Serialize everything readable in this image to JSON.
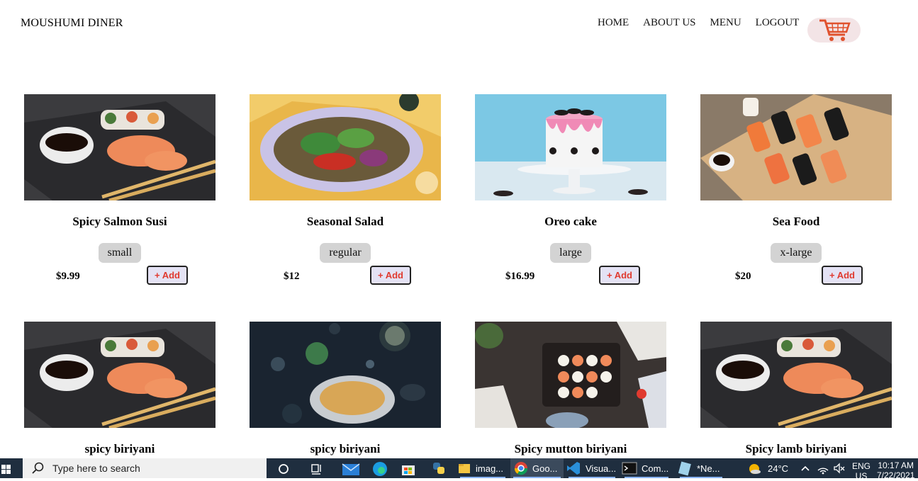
{
  "header": {
    "brand": "MOUSHUMI DINER",
    "nav": [
      "HOME",
      "ABOUT US",
      "MENU",
      "LOGOUT"
    ],
    "cart_icon": "shopping-cart-icon"
  },
  "add_label": "+ Add",
  "cards": [
    {
      "title": "Spicy Salmon Susi",
      "size": "small",
      "price": "$9.99"
    },
    {
      "title": "Seasonal Salad",
      "size": "regular",
      "price": "$12"
    },
    {
      "title": "Oreo cake",
      "size": "large",
      "price": "$16.99"
    },
    {
      "title": "Sea Food",
      "size": "x-large",
      "price": "$20"
    },
    {
      "title": "spicy biriyani"
    },
    {
      "title": "spicy biriyani"
    },
    {
      "title": "Spicy mutton biriyani"
    },
    {
      "title": "Spicy lamb biriyani"
    }
  ],
  "taskbar": {
    "search_placeholder": "Type here to search",
    "apps": [
      "imag...",
      "Goo...",
      "Visua...",
      "Com...",
      "*Ne..."
    ],
    "temperature": "24°C",
    "language": "ENG",
    "language_sub": "US",
    "time": "10:17 AM",
    "date": "7/22/2021"
  },
  "colors": {
    "accent": "#e03a2f",
    "button_bg": "#e4e2f4",
    "badge_bg": "#d3d3d3",
    "taskbar": "#1f2e3f"
  }
}
